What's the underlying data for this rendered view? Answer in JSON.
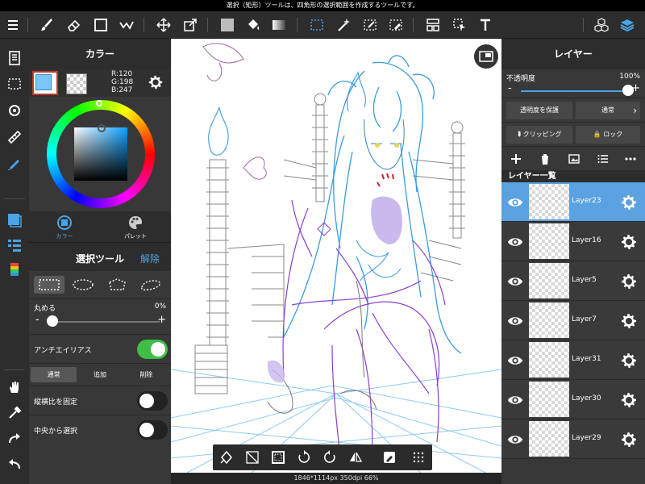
{
  "tipbar": {
    "text": "選択（矩形）ツールは、四角形の選択範囲を作成するツールです。"
  },
  "toolbar": {
    "icons": [
      "menu-icon",
      "brush-icon",
      "eraser-icon",
      "rectangle-icon",
      "stabilizer-icon",
      "move-icon",
      "transform-icon",
      "fill-color-icon",
      "bucket-icon",
      "gradient-icon",
      "select-rect-icon",
      "magic-wand-icon",
      "select-pen-icon",
      "select-eraser-icon",
      "layout-icon",
      "select-layer-icon",
      "text-icon",
      "3d-icon",
      "layers-icon"
    ]
  },
  "color_panel": {
    "title": "カラー",
    "rgb": {
      "r": "R:120",
      "g": "G:198",
      "b": "B:247"
    },
    "fg_color": "#78c6f7",
    "tabs": [
      {
        "label": "カラー",
        "active": true
      },
      {
        "label": "パレット",
        "active": false
      }
    ]
  },
  "select_tool": {
    "title": "選択ツール",
    "reset_label": "解除",
    "round": {
      "label": "丸める",
      "value": "0%",
      "level": 0
    },
    "antialias": {
      "label": "アンチエイリアス",
      "on": true
    },
    "modes": [
      {
        "label": "通常",
        "active": true
      },
      {
        "label": "追加",
        "active": false
      },
      {
        "label": "削除",
        "active": false
      }
    ],
    "fix_ratio": {
      "label": "縦横比を固定",
      "on": false
    },
    "from_center": {
      "label": "中央から選択",
      "on": false
    }
  },
  "canvas": {
    "status": "1846*1114px 350dpi 66%"
  },
  "layer_panel": {
    "title": "レイヤー",
    "opacity_label": "不透明度",
    "opacity_value": "100%",
    "opacity_level": 1.0,
    "protect_label": "透明度を保護",
    "blend_label": "通常",
    "clipping_label": "クリッピング",
    "lock_label": "ロック",
    "list_header": "レイヤー一覧",
    "layers": [
      {
        "name": "Layer23",
        "active": true
      },
      {
        "name": "Layer16",
        "active": false
      },
      {
        "name": "Layer5",
        "active": false
      },
      {
        "name": "Layer7",
        "active": false
      },
      {
        "name": "Layer31",
        "active": false
      },
      {
        "name": "Layer30",
        "active": false
      },
      {
        "name": "Layer29",
        "active": false
      }
    ]
  }
}
